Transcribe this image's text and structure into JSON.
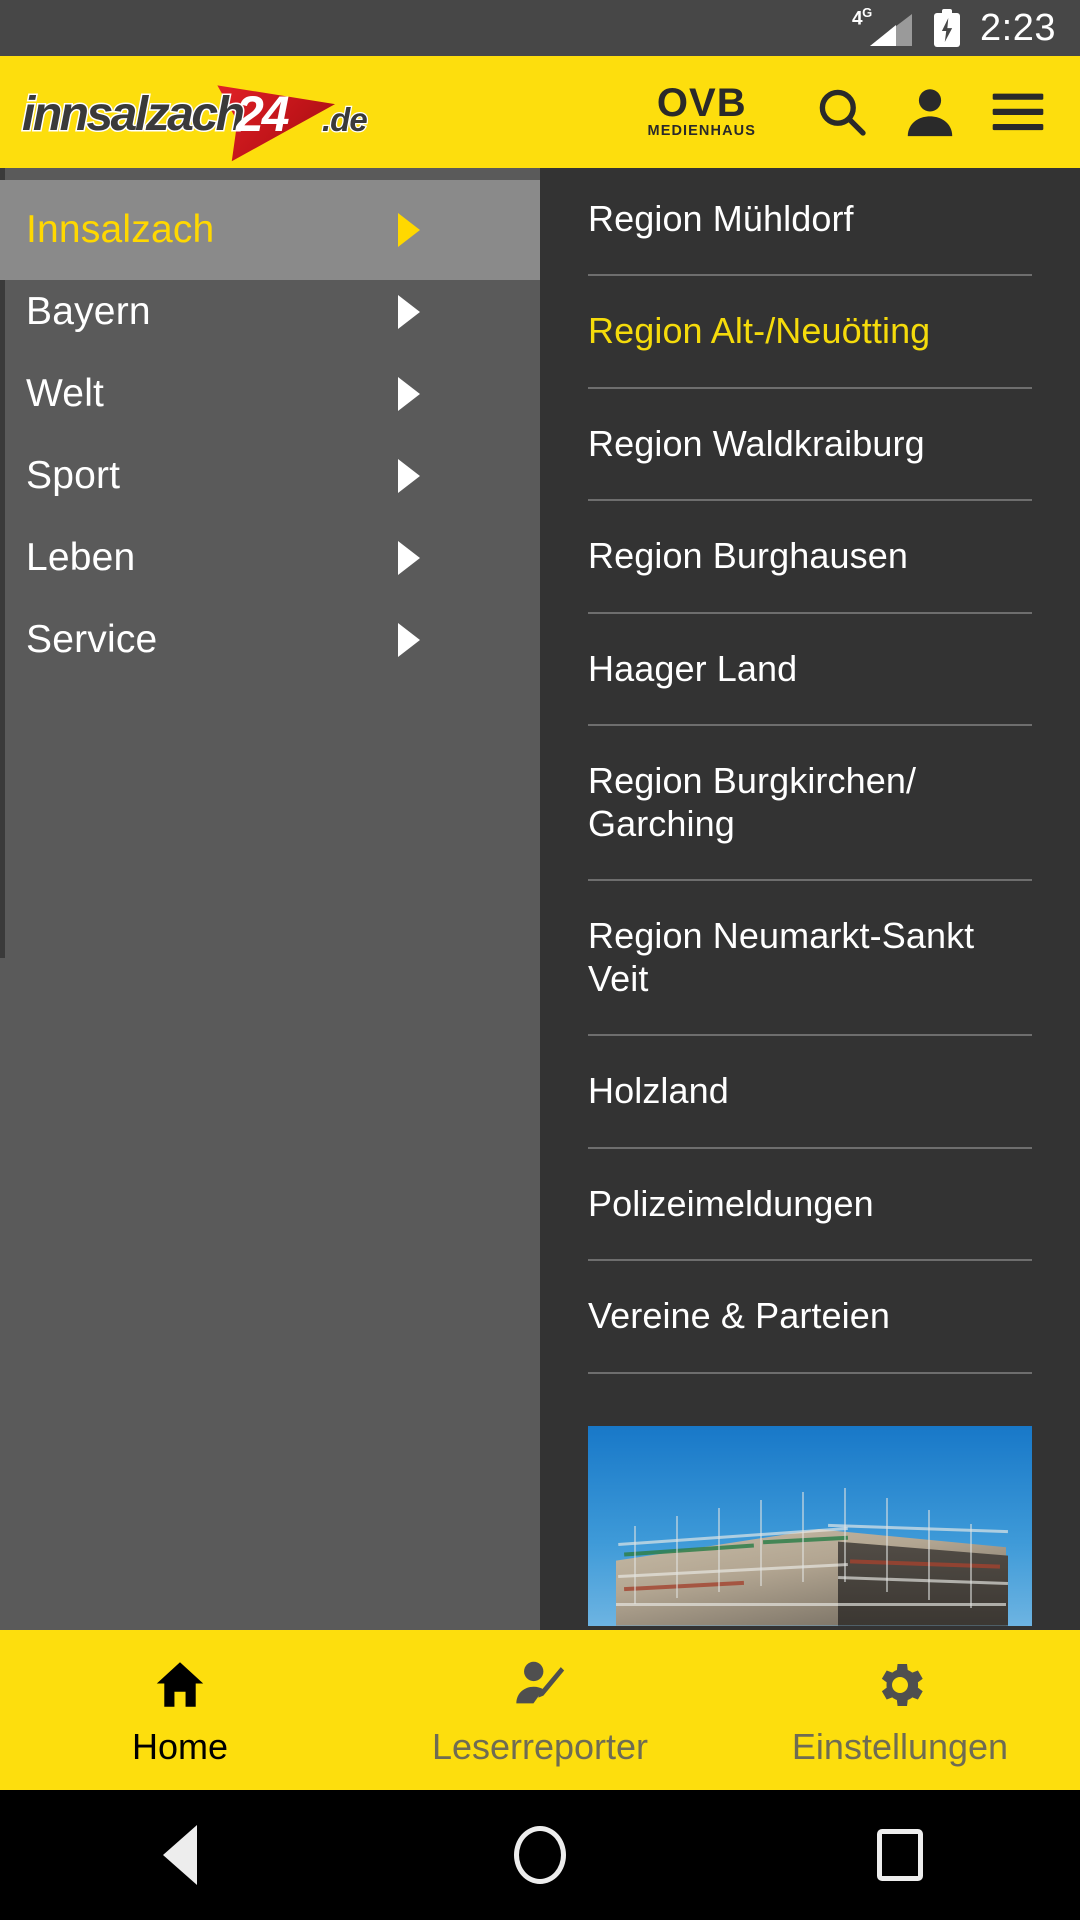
{
  "status_bar": {
    "network": "4G",
    "battery_state": "charging",
    "time": "2:23"
  },
  "header": {
    "logo": {
      "name": "innsalzach",
      "badge": "24",
      "tld": ".de"
    },
    "partner_logo": {
      "main": "OVB",
      "sub": "MEDIENHAUS"
    },
    "icons": [
      "search-icon",
      "account-icon",
      "hamburger-menu-icon"
    ]
  },
  "sidebar": {
    "items": [
      {
        "label": "Innsalzach",
        "active": true
      },
      {
        "label": "Bayern",
        "active": false
      },
      {
        "label": "Welt",
        "active": false
      },
      {
        "label": "Sport",
        "active": false
      },
      {
        "label": "Leben",
        "active": false
      },
      {
        "label": "Service",
        "active": false
      }
    ]
  },
  "submenu": {
    "items": [
      {
        "label": "Region Mühldorf",
        "highlight": false
      },
      {
        "label": "Region Alt-/Neuötting",
        "highlight": true
      },
      {
        "label": "Region Waldkraiburg",
        "highlight": false
      },
      {
        "label": "Region Burghausen",
        "highlight": false
      },
      {
        "label": "Haager Land",
        "highlight": false
      },
      {
        "label": "Region Burgkirchen/ Garching",
        "highlight": false
      },
      {
        "label": "Region Neumarkt-Sankt Veit",
        "highlight": false
      },
      {
        "label": "Holzland",
        "highlight": false
      },
      {
        "label": "Polizeimeldungen",
        "highlight": false
      },
      {
        "label": "Vereine & Parteien",
        "highlight": false
      }
    ],
    "teaser_image": "construction-building-with-scaffolding-photo"
  },
  "tabbar": {
    "tabs": [
      {
        "label": "Home",
        "icon": "home-icon",
        "active": true
      },
      {
        "label": "Leserreporter",
        "icon": "reporter-icon",
        "active": false
      },
      {
        "label": "Einstellungen",
        "icon": "gear-icon",
        "active": false
      }
    ]
  },
  "android_nav": {
    "back": "back-icon",
    "home": "home-circle-icon",
    "recents": "recents-square-icon"
  },
  "colors": {
    "brand_yellow": "#FDDE0D",
    "highlight_yellow": "#F5DB0B",
    "sidebar_gray": "#5A5A5A",
    "sidebar_active_gray": "#8A8A8A",
    "panel_dark": "#333333",
    "status_gray": "#474747",
    "logo_red": "#CE1A20"
  }
}
